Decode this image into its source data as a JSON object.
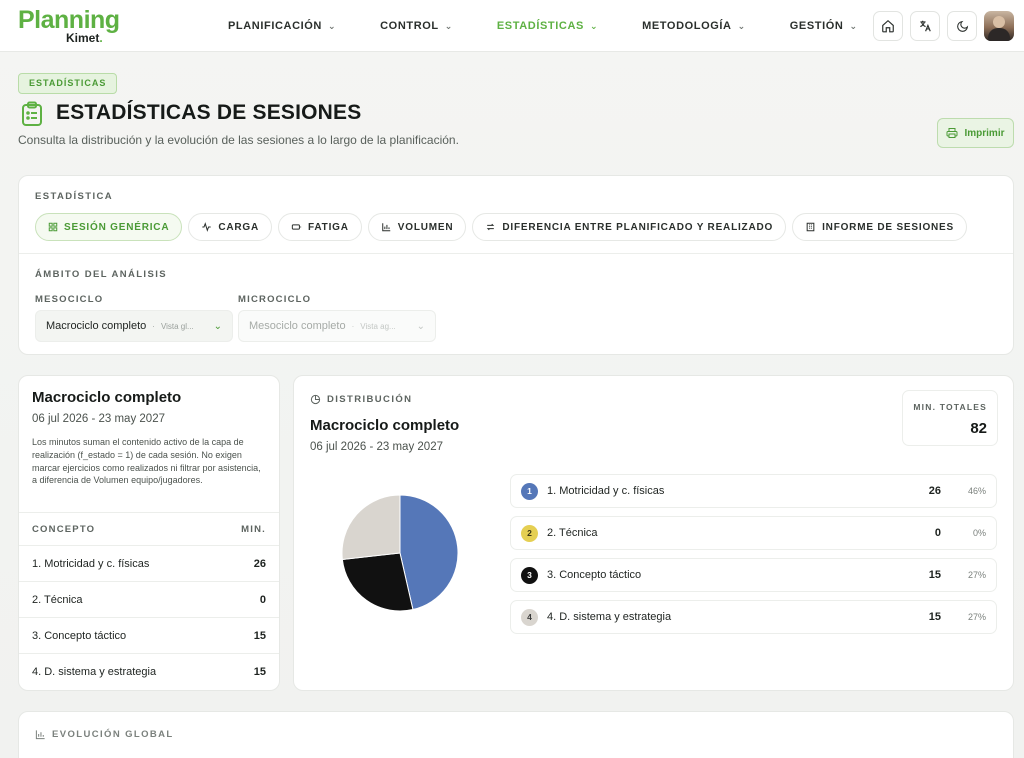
{
  "brand": {
    "name": "Planning",
    "sub": "Kimet",
    "sub_dot": "."
  },
  "nav": [
    {
      "label": "PLANIFICACIÓN",
      "active": false
    },
    {
      "label": "CONTROL",
      "active": false
    },
    {
      "label": "ESTADÍSTICAS",
      "active": true
    },
    {
      "label": "METODOLOGÍA",
      "active": false
    },
    {
      "label": "GESTIÓN",
      "active": false
    }
  ],
  "header": {
    "crumb": "ESTADÍSTICAS",
    "title": "ESTADÍSTICAS DE SESIONES",
    "subtitle": "Consulta la distribución y la evolución de las sesiones a lo largo de la planificación.",
    "print_label": "Imprimir"
  },
  "stats": {
    "label": "ESTADÍSTICA",
    "tabs": [
      {
        "label": "SESIÓN GENÉRICA",
        "icon": "grid-icon",
        "active": true
      },
      {
        "label": "CARGA",
        "icon": "pulse-icon",
        "active": false
      },
      {
        "label": "FATIGA",
        "icon": "battery-icon",
        "active": false
      },
      {
        "label": "VOLUMEN",
        "icon": "bar-chart-icon",
        "active": false
      },
      {
        "label": "DIFERENCIA ENTRE PLANIFICADO Y REALIZADO",
        "icon": "swap-icon",
        "active": false
      },
      {
        "label": "INFORME DE SESIONES",
        "icon": "building-icon",
        "active": false
      }
    ],
    "scope_label": "ÁMBITO DEL ANÁLISIS",
    "mesociclo": {
      "label": "MESOCICLO",
      "value": "Macrociclo completo",
      "hint": "Vista gl..."
    },
    "microciclo": {
      "label": "MICROCICLO",
      "value": "Mesociclo completo",
      "hint": "Vista ag..."
    }
  },
  "summary": {
    "title": "Macrociclo completo",
    "dates": "06 jul 2026 - 23 may 2027",
    "note": "Los minutos suman el contenido activo de la capa de realización (f_estado = 1) de cada sesión. No exigen marcar ejercicios como realizados ni filtrar por asistencia, a diferencia de Volumen equipo/jugadores.",
    "col_concept": "CONCEPTO",
    "col_min": "MIN.",
    "rows": [
      {
        "concept": "1. Motricidad y c. físicas",
        "min": "26"
      },
      {
        "concept": "2. Técnica",
        "min": "0"
      },
      {
        "concept": "3. Concepto táctico",
        "min": "15"
      },
      {
        "concept": "4. D. sistema y estrategia",
        "min": "15"
      }
    ]
  },
  "distribution": {
    "label": "DISTRIBUCIÓN",
    "title": "Macrociclo completo",
    "dates": "06 jul 2026 - 23 may 2027",
    "total_label": "MIN. TOTALES",
    "total_value": "82"
  },
  "chart_data": {
    "type": "pie",
    "slices": [
      {
        "num": "1",
        "label": "1. Motricidad y c. físicas",
        "value": 26,
        "pct": "46%",
        "color": "#5577b8"
      },
      {
        "num": "2",
        "label": "2. Técnica",
        "value": 0,
        "pct": "0%",
        "color": "#e5cf52"
      },
      {
        "num": "3",
        "label": "3. Concepto táctico",
        "value": 15,
        "pct": "27%",
        "color": "#111111"
      },
      {
        "num": "4",
        "label": "4. D. sistema y estrategia",
        "value": 15,
        "pct": "27%",
        "color": "#d9d5cf"
      }
    ]
  },
  "evolution": {
    "label": "EVOLUCIÓN GLOBAL"
  },
  "colors": {
    "accent": "#5eb143",
    "accent_dark": "#4a9a35"
  }
}
